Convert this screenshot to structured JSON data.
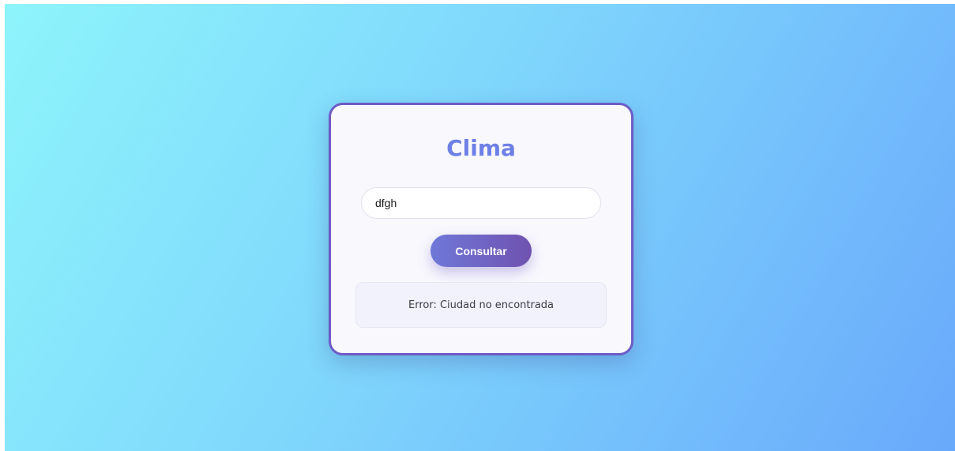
{
  "app": {
    "title": "Clima"
  },
  "search": {
    "value": "dfgh",
    "button_label": "Consultar"
  },
  "result": {
    "message": "Error: Ciudad no encontrada"
  },
  "colors": {
    "accent": "#6e80e6",
    "button_start": "#6f78d8",
    "button_end": "#7052b0",
    "card_border": "#6c5cc6"
  }
}
